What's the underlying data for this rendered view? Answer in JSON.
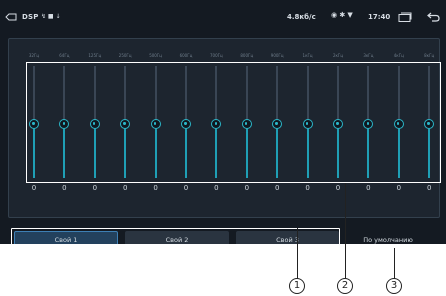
{
  "status_bar": {
    "app_label": "DSP",
    "net_speed": "4.8кб/с",
    "time": "17:40"
  },
  "equalizer": {
    "bands": [
      {
        "freq": "32Гц",
        "value": "0"
      },
      {
        "freq": "64Гц",
        "value": "0"
      },
      {
        "freq": "125Гц",
        "value": "0"
      },
      {
        "freq": "250Гц",
        "value": "0"
      },
      {
        "freq": "500Гц",
        "value": "0"
      },
      {
        "freq": "600Гц",
        "value": "0"
      },
      {
        "freq": "700Гц",
        "value": "0"
      },
      {
        "freq": "800Гц",
        "value": "0"
      },
      {
        "freq": "900Гц",
        "value": "0"
      },
      {
        "freq": "1кГц",
        "value": "0"
      },
      {
        "freq": "2кГц",
        "value": "0"
      },
      {
        "freq": "3кГц",
        "value": "0"
      },
      {
        "freq": "4кГц",
        "value": "0"
      },
      {
        "freq": "8кГц",
        "value": "0"
      },
      {
        "freq": "16кГц",
        "value": "0"
      }
    ],
    "level_fraction": 0.5
  },
  "presets": {
    "items": [
      {
        "label": "Свой 1",
        "active": true
      },
      {
        "label": "Свой 2",
        "active": false
      },
      {
        "label": "Свой 3",
        "active": false
      }
    ],
    "default_label": "По умолчанию"
  },
  "callouts": [
    "1",
    "2",
    "3"
  ],
  "colors": {
    "accent": "#2bb7c9",
    "background": "#141a22",
    "active_preset": "#23415d"
  }
}
